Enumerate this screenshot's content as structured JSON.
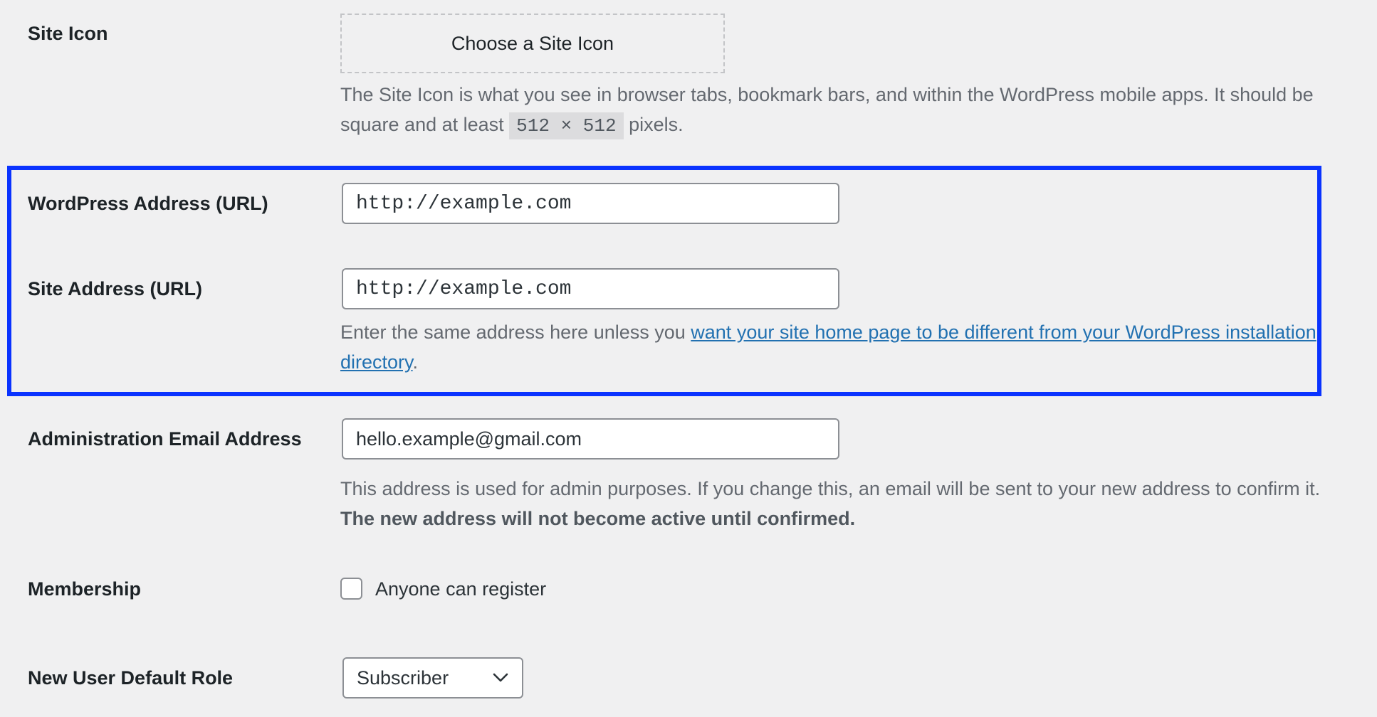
{
  "site_icon": {
    "label": "Site Icon",
    "button_label": "Choose a Site Icon",
    "description_before": "The Site Icon is what you see in browser tabs, bookmark bars, and within the WordPress mobile apps. It should be square and at least ",
    "description_code": "512 × 512",
    "description_after": " pixels."
  },
  "wordpress_address": {
    "label": "WordPress Address (URL)",
    "value": "http://example.com"
  },
  "site_address": {
    "label": "Site Address (URL)",
    "value": "http://example.com",
    "description_before": "Enter the same address here unless you ",
    "description_link": "want your site home page to be different from your WordPress installation directory",
    "description_after": "."
  },
  "admin_email": {
    "label": "Administration Email Address",
    "value": "hello.example@gmail.com",
    "description_before": "This address is used for admin purposes. If you change this, an email will be sent to your new address to confirm it. ",
    "description_bold": "The new address will not become active until confirmed."
  },
  "membership": {
    "label": "Membership",
    "checkbox_label": "Anyone can register",
    "checked": false
  },
  "default_role": {
    "label": "New User Default Role",
    "selected": "Subscriber"
  },
  "colors": {
    "highlight_border": "#0a33ff",
    "link": "#2271b1",
    "background": "#f0f0f1"
  }
}
